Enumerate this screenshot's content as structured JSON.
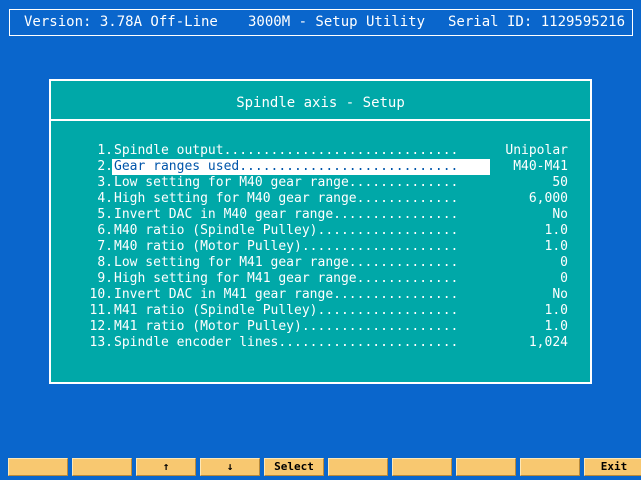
{
  "colors": {
    "background": "#0a66cc",
    "dialog": "#00a8a8",
    "fkey": "#f8c870",
    "text": "#ffffff",
    "selected_text": "#0055aa"
  },
  "header": {
    "version": "Version: 3.78A Off-Line",
    "title": "3000M - Setup Utility",
    "serial": "Serial ID: 1129595216"
  },
  "dialog": {
    "title": "Spindle axis - Setup",
    "selected_index": 1,
    "items": [
      {
        "num": "1.",
        "label": "Spindle output..............................",
        "value": "Unipolar"
      },
      {
        "num": "2.",
        "label": "Gear ranges used............................",
        "value": "M40-M41"
      },
      {
        "num": "3.",
        "label": "Low setting for M40 gear range..............",
        "value": "50"
      },
      {
        "num": "4.",
        "label": "High setting for M40 gear range.............",
        "value": "6,000"
      },
      {
        "num": "5.",
        "label": "Invert DAC in M40 gear range................",
        "value": "No"
      },
      {
        "num": "6.",
        "label": "M40 ratio (Spindle Pulley)..................",
        "value": "1.0"
      },
      {
        "num": "7.",
        "label": "M40 ratio (Motor Pulley)....................",
        "value": "1.0"
      },
      {
        "num": "8.",
        "label": "Low setting for M41 gear range..............",
        "value": "0"
      },
      {
        "num": "9.",
        "label": "High setting for M41 gear range.............",
        "value": "0"
      },
      {
        "num": "10.",
        "label": "Invert DAC in M41 gear range................",
        "value": "No"
      },
      {
        "num": "11.",
        "label": "M41 ratio (Spindle Pulley)..................",
        "value": "1.0"
      },
      {
        "num": "12.",
        "label": "M41 ratio (Motor Pulley)....................",
        "value": "1.0"
      },
      {
        "num": "13.",
        "label": "Spindle encoder lines.......................",
        "value": "1,024"
      }
    ]
  },
  "function_keys": [
    {
      "label": "",
      "name": "fkey-1"
    },
    {
      "label": "",
      "name": "fkey-2"
    },
    {
      "label": "↑",
      "name": "fkey-up-arrow"
    },
    {
      "label": "↓",
      "name": "fkey-down-arrow"
    },
    {
      "label": "Select",
      "name": "fkey-select"
    },
    {
      "label": "",
      "name": "fkey-6"
    },
    {
      "label": "",
      "name": "fkey-7"
    },
    {
      "label": "",
      "name": "fkey-8"
    },
    {
      "label": "",
      "name": "fkey-9"
    },
    {
      "label": "Exit",
      "name": "fkey-exit"
    }
  ]
}
